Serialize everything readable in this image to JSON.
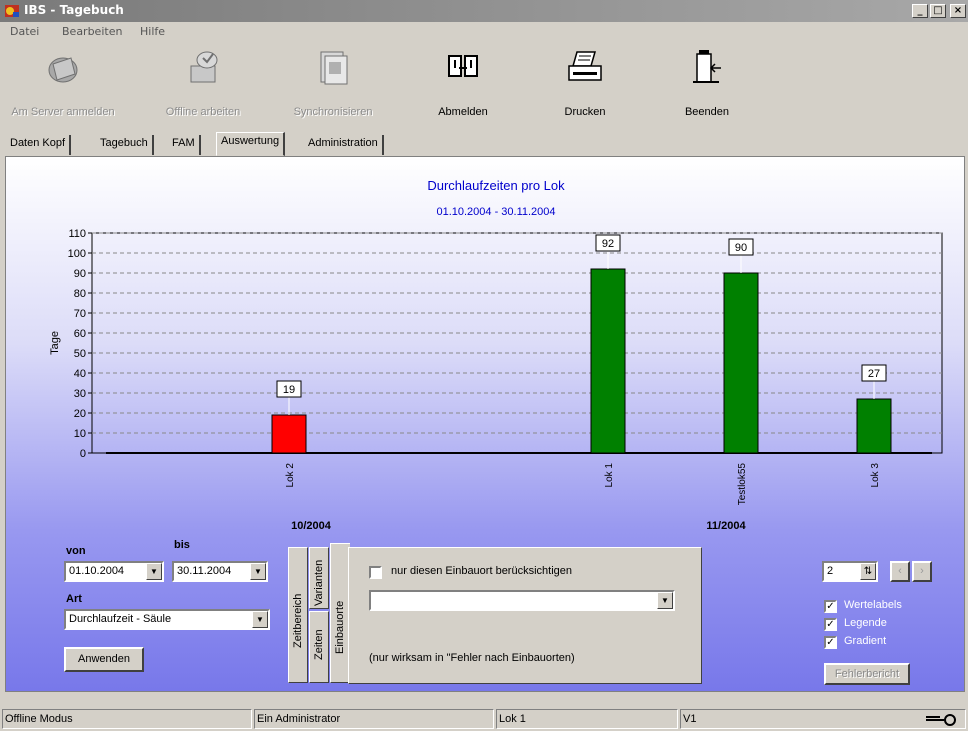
{
  "window": {
    "title": "IBS - Tagebuch"
  },
  "menu": [
    "Datei",
    "Bearbeiten",
    "Hilfe"
  ],
  "toolbar": {
    "buttons": [
      {
        "label": "Am Server anmelden",
        "icon": "server-login-icon",
        "enabled": false
      },
      {
        "label": "Offline arbeiten",
        "icon": "offline-work-icon",
        "enabled": false
      },
      {
        "label": "Synchronisieren",
        "icon": "synchronize-icon",
        "enabled": false
      },
      {
        "label": "Abmelden",
        "icon": "logout-icon",
        "enabled": true
      },
      {
        "label": "Drucken",
        "icon": "printer-icon",
        "enabled": true
      },
      {
        "label": "Beenden",
        "icon": "exit-door-icon",
        "enabled": true
      }
    ]
  },
  "tabs": [
    {
      "label": "Daten Kopf"
    },
    {
      "label": "Tagebuch"
    },
    {
      "label": "FAM"
    },
    {
      "label": "Auswertung",
      "active": true
    },
    {
      "label": "Administration"
    }
  ],
  "chart_data": {
    "type": "bar",
    "title": "Durchlaufzeiten pro Lok",
    "subtitle": "01.10.2004 - 30.11.2004",
    "ylabel": "Tage",
    "ylim": [
      0,
      110
    ],
    "yticks": [
      0,
      10,
      20,
      30,
      40,
      50,
      60,
      70,
      80,
      90,
      100,
      110
    ],
    "grid": true,
    "groups": [
      {
        "label": "10/2004",
        "categories": [
          "Lok 2"
        ],
        "values": [
          19
        ],
        "colors": [
          "#ff0000"
        ]
      },
      {
        "label": "11/2004",
        "categories": [
          "Lok 1",
          "Testlok55",
          "Lok 3"
        ],
        "values": [
          92,
          90,
          27
        ],
        "colors": [
          "#008000",
          "#008000",
          "#008000"
        ]
      }
    ]
  },
  "filters": {
    "von_label": "von",
    "bis_label": "bis",
    "von_value": "01.10.2004",
    "bis_value": "30.11.2004",
    "art_label": "Art",
    "art_value": "Durchlaufzeit - Säule",
    "apply_label": "Anwenden"
  },
  "panel": {
    "vtabs": [
      "Zeitbereich",
      "Zeiten",
      "Varianten",
      "Einbauorte"
    ],
    "checkbox_label": "nur diesen Einbauort berücksichtigen",
    "checkbox_checked": false,
    "dropdown_value": "",
    "note": "(nur wirksam in \"Fehler nach Einbauorten)"
  },
  "right": {
    "spin_value": "2",
    "options": [
      {
        "label": "Wertelabels",
        "checked": true
      },
      {
        "label": "Legende",
        "checked": true
      },
      {
        "label": "Gradient",
        "checked": true
      }
    ],
    "report_button": "Fehlerbericht"
  },
  "status": [
    "Offline Modus",
    "Ein Administrator",
    "Lok 1",
    "V1"
  ]
}
